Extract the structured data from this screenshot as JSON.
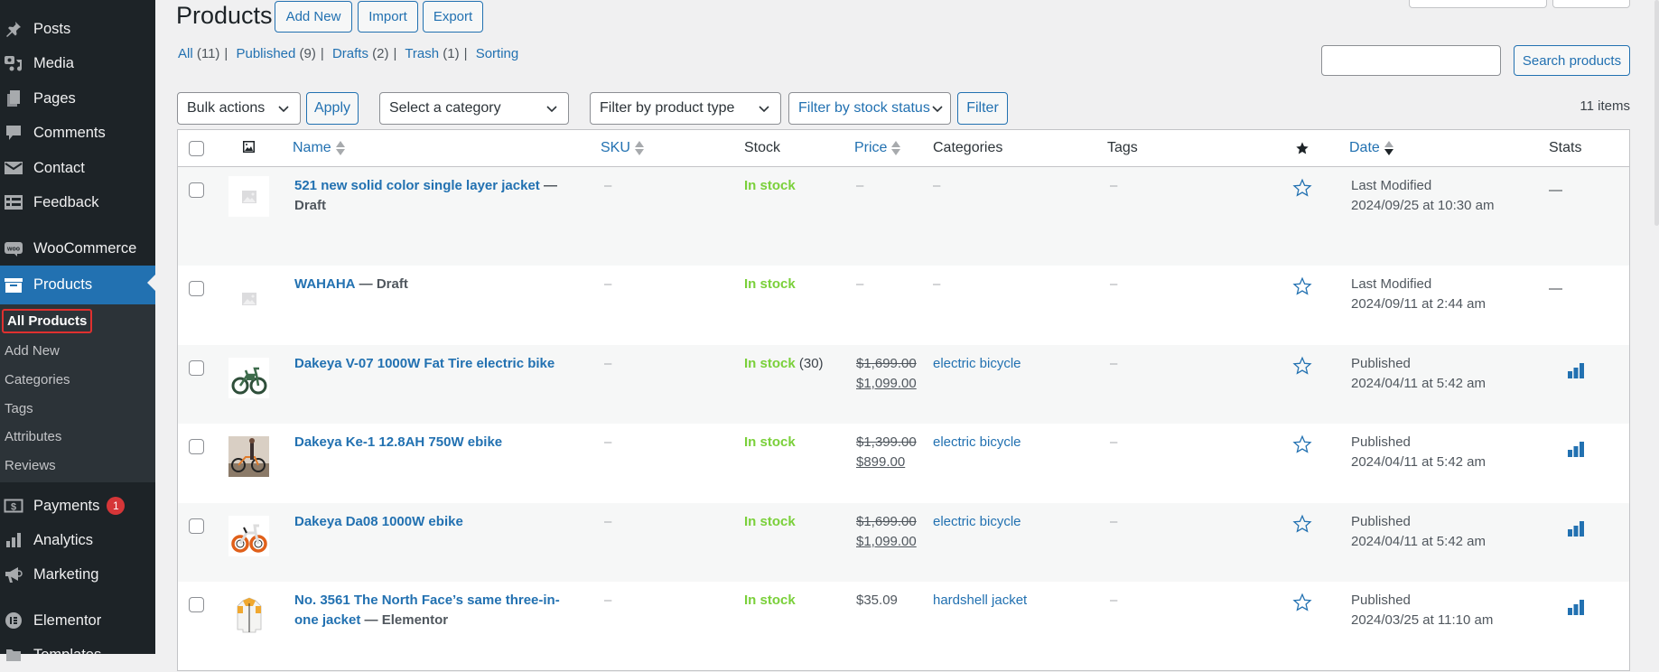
{
  "sidebar": {
    "items": [
      {
        "label": "Posts",
        "icon": "pin-icon"
      },
      {
        "label": "Media",
        "icon": "media-icon"
      },
      {
        "label": "Pages",
        "icon": "pages-icon"
      },
      {
        "label": "Comments",
        "icon": "comment-icon"
      },
      {
        "label": "Contact",
        "icon": "envelope-icon"
      },
      {
        "label": "Feedback",
        "icon": "feedback-icon"
      },
      {
        "label": "WooCommerce",
        "icon": "woo-icon"
      },
      {
        "label": "Products",
        "icon": "archive-icon",
        "active": true
      },
      {
        "label": "Payments",
        "icon": "dollar-icon",
        "badge": "1"
      },
      {
        "label": "Analytics",
        "icon": "bar-chart-icon"
      },
      {
        "label": "Marketing",
        "icon": "megaphone-icon"
      },
      {
        "label": "Elementor",
        "icon": "elementor-icon"
      },
      {
        "label": "Templates",
        "icon": "folder-icon"
      }
    ],
    "submenu": [
      {
        "label": "All Products",
        "current": true
      },
      {
        "label": "Add New"
      },
      {
        "label": "Categories"
      },
      {
        "label": "Tags"
      },
      {
        "label": "Attributes"
      },
      {
        "label": "Reviews"
      }
    ]
  },
  "header": {
    "title": "Products",
    "buttons": {
      "add_new": "Add New",
      "import": "Import",
      "export": "Export"
    }
  },
  "views": [
    {
      "label": "All",
      "count": "(11)"
    },
    {
      "label": "Published",
      "count": "(9)"
    },
    {
      "label": "Drafts",
      "count": "(2)"
    },
    {
      "label": "Trash",
      "count": "(1)"
    },
    {
      "label": "Sorting",
      "count": ""
    }
  ],
  "search": {
    "value": "",
    "placeholder": "",
    "button": "Search products"
  },
  "filters": {
    "bulk_actions": "Bulk actions",
    "apply": "Apply",
    "category": "Select a category",
    "product_type": "Filter by product type",
    "stock_status": "Filter by stock status",
    "filter": "Filter"
  },
  "items_count": "11 items",
  "table": {
    "columns": {
      "name": "Name",
      "sku": "SKU",
      "stock": "Stock",
      "price": "Price",
      "categories": "Categories",
      "tags": "Tags",
      "date": "Date",
      "stats": "Stats"
    },
    "rows": [
      {
        "name": "521 new solid color single layer jacket",
        "state": "— Draft",
        "sku": "–",
        "stock": "In stock",
        "stock_qty": "",
        "price_regular": "",
        "price_sale": "",
        "price": "–",
        "category": "–",
        "tags": "–",
        "date_status": "Last Modified",
        "date": "2024/09/25 at 10:30 am",
        "stats": "—",
        "thumb": "placeholder"
      },
      {
        "name": "WAHAHA",
        "state": "— Draft",
        "sku": "–",
        "stock": "In stock",
        "stock_qty": "",
        "price_regular": "",
        "price_sale": "",
        "price": "–",
        "category": "–",
        "tags": "–",
        "date_status": "Last Modified",
        "date": "2024/09/11 at 2:44 am",
        "stats": "—",
        "thumb": "placeholder"
      },
      {
        "name": "Dakeya V-07 1000W Fat Tire electric bike",
        "state": "",
        "sku": "–",
        "stock": "In stock",
        "stock_qty": "(30)",
        "price_regular": "$1,699.00",
        "price_sale": "$1,099.00",
        "price": "",
        "category": "electric bicycle",
        "tags": "–",
        "date_status": "Published",
        "date": "2024/04/11 at 5:42 am",
        "stats": "chart",
        "thumb": "bike-green"
      },
      {
        "name": "Dakeya Ke-1 12.8AH 750W ebike",
        "state": "",
        "sku": "–",
        "stock": "In stock",
        "stock_qty": "",
        "price_regular": "$1,399.00",
        "price_sale": "$899.00",
        "price": "",
        "category": "electric bicycle",
        "tags": "–",
        "date_status": "Published",
        "date": "2024/04/11 at 5:42 am",
        "stats": "chart",
        "thumb": "bike-photo"
      },
      {
        "name": "Dakeya Da08 1000W ebike",
        "state": "",
        "sku": "–",
        "stock": "In stock",
        "stock_qty": "",
        "price_regular": "$1,699.00",
        "price_sale": "$1,099.00",
        "price": "",
        "category": "electric bicycle",
        "tags": "–",
        "date_status": "Published",
        "date": "2024/04/11 at 5:42 am",
        "stats": "chart",
        "thumb": "bike-orange"
      },
      {
        "name": "No. 3561 The North Face’s same three-in-one jacket",
        "name_line1": "No. 3561 The North Face’s same three-in-",
        "name_line2": "one jacket",
        "state": "— Elementor",
        "sku": "–",
        "stock": "In stock",
        "stock_qty": "",
        "price_regular": "",
        "price_sale": "",
        "price": "$35.09",
        "category": "hardshell jacket",
        "tags": "–",
        "date_status": "Published",
        "date": "2024/03/25 at 11:10 am",
        "stats": "chart",
        "thumb": "jacket"
      }
    ]
  },
  "colors": {
    "accent": "#2271b1",
    "sidebar_bg": "#1d2327",
    "in_stock": "#7ad03a",
    "badge": "#d63638",
    "highlight_box": "#e0302f"
  }
}
